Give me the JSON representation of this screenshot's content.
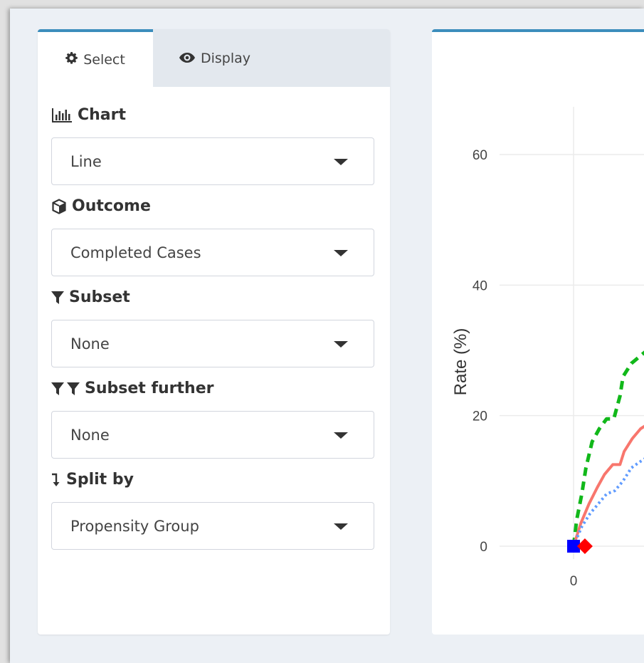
{
  "tabs": [
    {
      "label": "Select",
      "icon": "gear-icon",
      "active": true
    },
    {
      "label": "Display",
      "icon": "eye-icon",
      "active": false
    }
  ],
  "fields": {
    "chart": {
      "label": "Chart",
      "icon": "bar-chart-icon",
      "value": "Line"
    },
    "outcome": {
      "label": "Outcome",
      "icon": "cube-icon",
      "value": "Completed Cases"
    },
    "subset": {
      "label": "Subset",
      "icon": "filter-icon",
      "value": "None"
    },
    "subset_further": {
      "label": "Subset further",
      "icon": "double-filter-icon",
      "value": "None"
    },
    "split_by": {
      "label": "Split by",
      "icon": "arrow-down-split-icon",
      "value": "Propensity Group"
    }
  },
  "colors": {
    "accent": "#3c8dbc",
    "series_green": "#11b81a",
    "series_red": "#f8766d",
    "series_blue": "#619cff",
    "marker_square": "#0000ff",
    "marker_diamond": "#ff0000"
  },
  "chart_data": {
    "type": "line",
    "ylabel": "Rate (%)",
    "xlabel": "",
    "ylim": [
      0,
      66
    ],
    "y_ticks": [
      0,
      20,
      40,
      60
    ],
    "x_ticks": [
      0
    ],
    "grid": true,
    "series": [
      {
        "style": "dashed",
        "color": "#11b81a",
        "x": [
          0,
          0.3,
          0.8,
          1.2,
          1.8,
          2.5,
          3.2,
          3.9,
          4.5,
          4.8,
          5.6,
          7.5
        ],
        "y": [
          0,
          4,
          8,
          12,
          16,
          18,
          19.5,
          19.5,
          23,
          26,
          28,
          30.5
        ]
      },
      {
        "style": "solid",
        "color": "#f8766d",
        "x": [
          0,
          0.7,
          1.5,
          2.3,
          3.0,
          3.8,
          4.5,
          4.9,
          5.7,
          6.5,
          7.5
        ],
        "y": [
          0,
          3.5,
          6.5,
          9,
          11,
          12.5,
          12.5,
          14.5,
          16.5,
          18,
          19
        ]
      },
      {
        "style": "dotted",
        "color": "#619cff",
        "x": [
          0,
          0.8,
          1.6,
          2.4,
          3.2,
          4.0,
          4.8,
          5.6,
          6.5,
          7.5
        ],
        "y": [
          0,
          3,
          5,
          6.5,
          8,
          8.5,
          10,
          12,
          13,
          14
        ]
      }
    ],
    "markers": [
      {
        "shape": "square",
        "color": "#0000ff",
        "x": 0,
        "y": 0
      },
      {
        "shape": "diamond",
        "color": "#ff0000",
        "x": 1.1,
        "y": 0
      }
    ]
  }
}
